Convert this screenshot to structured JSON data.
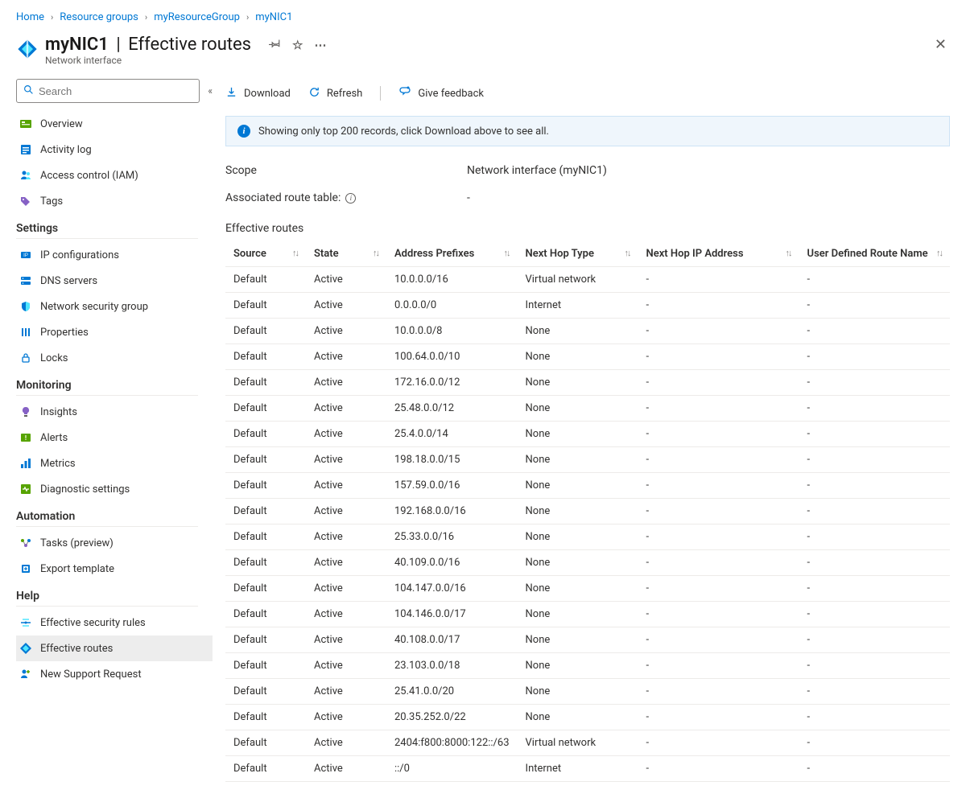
{
  "breadcrumb": [
    {
      "label": "Home"
    },
    {
      "label": "Resource groups"
    },
    {
      "label": "myResourceGroup"
    },
    {
      "label": "myNIC1"
    }
  ],
  "header": {
    "resource_name": "myNIC1",
    "page_title": "Effective routes",
    "subtitle": "Network interface"
  },
  "search": {
    "placeholder": "Search"
  },
  "nav": {
    "top": [
      {
        "key": "overview",
        "label": "Overview",
        "icon_color": "#57a300"
      },
      {
        "key": "activity-log",
        "label": "Activity log",
        "icon_color": "#0078d4"
      },
      {
        "key": "access-control",
        "label": "Access control (IAM)",
        "icon_color": "#0078d4"
      },
      {
        "key": "tags",
        "label": "Tags",
        "icon_color": "#8661c5"
      }
    ],
    "settings_header": "Settings",
    "settings": [
      {
        "key": "ip-configurations",
        "label": "IP configurations",
        "icon_color": "#0078d4"
      },
      {
        "key": "dns-servers",
        "label": "DNS servers",
        "icon_color": "#0078d4"
      },
      {
        "key": "nsg",
        "label": "Network security group",
        "icon_color": "#0078d4"
      },
      {
        "key": "properties",
        "label": "Properties",
        "icon_color": "#0078d4"
      },
      {
        "key": "locks",
        "label": "Locks",
        "icon_color": "#0078d4"
      }
    ],
    "monitoring_header": "Monitoring",
    "monitoring": [
      {
        "key": "insights",
        "label": "Insights",
        "icon_color": "#8661c5"
      },
      {
        "key": "alerts",
        "label": "Alerts",
        "icon_color": "#57a300"
      },
      {
        "key": "metrics",
        "label": "Metrics",
        "icon_color": "#0078d4"
      },
      {
        "key": "diagnostic",
        "label": "Diagnostic settings",
        "icon_color": "#57a300"
      }
    ],
    "automation_header": "Automation",
    "automation": [
      {
        "key": "tasks",
        "label": "Tasks (preview)",
        "icon_color": "#0078d4"
      },
      {
        "key": "export-template",
        "label": "Export template",
        "icon_color": "#0078d4"
      }
    ],
    "help_header": "Help",
    "help": [
      {
        "key": "effective-security-rules",
        "label": "Effective security rules",
        "icon_color": "#0078d4"
      },
      {
        "key": "effective-routes",
        "label": "Effective routes",
        "icon_color": "#0078d4",
        "selected": true
      },
      {
        "key": "new-support",
        "label": "New Support Request",
        "icon_color": "#0078d4"
      }
    ]
  },
  "toolbar": {
    "download": "Download",
    "refresh": "Refresh",
    "feedback": "Give feedback"
  },
  "banner": {
    "text": "Showing only top 200 records, click Download above to see all."
  },
  "fields": {
    "scope_label": "Scope",
    "scope_value": "Network interface (myNIC1)",
    "assoc_label": "Associated route table:",
    "assoc_value": "-",
    "routes_label": "Effective routes"
  },
  "table": {
    "headers": {
      "source": "Source",
      "state": "State",
      "prefix": "Address Prefixes",
      "hop_type": "Next Hop Type",
      "hop_ip": "Next Hop IP Address",
      "udr_name": "User Defined Route Name"
    },
    "rows": [
      {
        "source": "Default",
        "state": "Active",
        "prefix": "10.0.0.0/16",
        "hop_type": "Virtual network",
        "hop_ip": "-",
        "udr_name": "-"
      },
      {
        "source": "Default",
        "state": "Active",
        "prefix": "0.0.0.0/0",
        "hop_type": "Internet",
        "hop_ip": "-",
        "udr_name": "-"
      },
      {
        "source": "Default",
        "state": "Active",
        "prefix": "10.0.0.0/8",
        "hop_type": "None",
        "hop_ip": "-",
        "udr_name": "-"
      },
      {
        "source": "Default",
        "state": "Active",
        "prefix": "100.64.0.0/10",
        "hop_type": "None",
        "hop_ip": "-",
        "udr_name": "-"
      },
      {
        "source": "Default",
        "state": "Active",
        "prefix": "172.16.0.0/12",
        "hop_type": "None",
        "hop_ip": "-",
        "udr_name": "-"
      },
      {
        "source": "Default",
        "state": "Active",
        "prefix": "25.48.0.0/12",
        "hop_type": "None",
        "hop_ip": "-",
        "udr_name": "-"
      },
      {
        "source": "Default",
        "state": "Active",
        "prefix": "25.4.0.0/14",
        "hop_type": "None",
        "hop_ip": "-",
        "udr_name": "-"
      },
      {
        "source": "Default",
        "state": "Active",
        "prefix": "198.18.0.0/15",
        "hop_type": "None",
        "hop_ip": "-",
        "udr_name": "-"
      },
      {
        "source": "Default",
        "state": "Active",
        "prefix": "157.59.0.0/16",
        "hop_type": "None",
        "hop_ip": "-",
        "udr_name": "-"
      },
      {
        "source": "Default",
        "state": "Active",
        "prefix": "192.168.0.0/16",
        "hop_type": "None",
        "hop_ip": "-",
        "udr_name": "-"
      },
      {
        "source": "Default",
        "state": "Active",
        "prefix": "25.33.0.0/16",
        "hop_type": "None",
        "hop_ip": "-",
        "udr_name": "-"
      },
      {
        "source": "Default",
        "state": "Active",
        "prefix": "40.109.0.0/16",
        "hop_type": "None",
        "hop_ip": "-",
        "udr_name": "-"
      },
      {
        "source": "Default",
        "state": "Active",
        "prefix": "104.147.0.0/16",
        "hop_type": "None",
        "hop_ip": "-",
        "udr_name": "-"
      },
      {
        "source": "Default",
        "state": "Active",
        "prefix": "104.146.0.0/17",
        "hop_type": "None",
        "hop_ip": "-",
        "udr_name": "-"
      },
      {
        "source": "Default",
        "state": "Active",
        "prefix": "40.108.0.0/17",
        "hop_type": "None",
        "hop_ip": "-",
        "udr_name": "-"
      },
      {
        "source": "Default",
        "state": "Active",
        "prefix": "23.103.0.0/18",
        "hop_type": "None",
        "hop_ip": "-",
        "udr_name": "-"
      },
      {
        "source": "Default",
        "state": "Active",
        "prefix": "25.41.0.0/20",
        "hop_type": "None",
        "hop_ip": "-",
        "udr_name": "-"
      },
      {
        "source": "Default",
        "state": "Active",
        "prefix": "20.35.252.0/22",
        "hop_type": "None",
        "hop_ip": "-",
        "udr_name": "-"
      },
      {
        "source": "Default",
        "state": "Active",
        "prefix": "2404:f800:8000:122::/63",
        "hop_type": "Virtual network",
        "hop_ip": "-",
        "udr_name": "-"
      },
      {
        "source": "Default",
        "state": "Active",
        "prefix": "::/0",
        "hop_type": "Internet",
        "hop_ip": "-",
        "udr_name": "-"
      }
    ]
  }
}
